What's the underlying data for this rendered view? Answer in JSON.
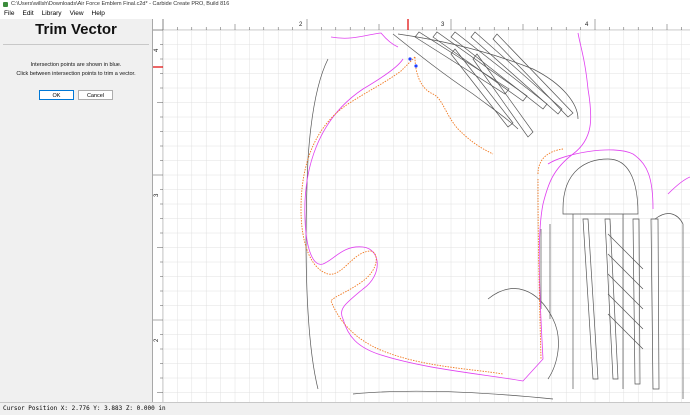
{
  "window": {
    "title": "C:\\Users\\willsh\\Downloads\\Air Force Emblem Final.c2d* - Carbide Create PRO, Build 816"
  },
  "menu": {
    "items": [
      "File",
      "Edit",
      "Library",
      "View",
      "Help"
    ]
  },
  "panel": {
    "title": "Trim Vector",
    "line1": "Intersection points are shown in blue.",
    "line2": "Click between intersection points to trim a vector.",
    "ok_label": "OK",
    "cancel_label": "Cancel"
  },
  "ruler": {
    "top_labels": [
      "2",
      "3",
      "4"
    ],
    "left_labels": [
      "4",
      "3",
      "2"
    ]
  },
  "status": {
    "text": "Cursor Position X: 2.776 Y: 3.883 Z: 0.000 in"
  },
  "colors": {
    "orange_path": "#f07820",
    "magenta_path": "#e040f0",
    "cursor_marker": "#e00000",
    "grid": "#e0e0e0"
  }
}
